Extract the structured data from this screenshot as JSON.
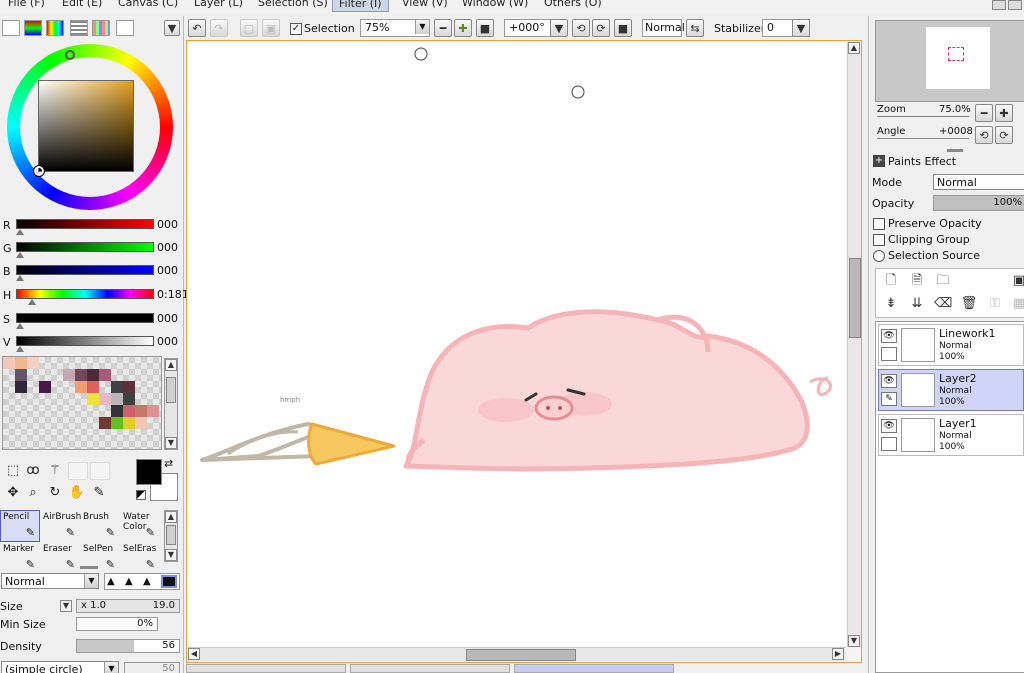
{
  "menu": {
    "items": [
      "File (F)",
      "Edit (E)",
      "Canvas (C)",
      "Layer (L)",
      "Selection (S)",
      "Filter (I)",
      "View (V)",
      "Window (W)",
      "Others (O)"
    ],
    "active_index": 5
  },
  "toolbar": {
    "selection_label": "Selection",
    "zoom_value": "75%",
    "angle_value": "+000°",
    "blend_value": "Normal",
    "stabilizer_label": "Stabilizer",
    "stabilizer_value": "0"
  },
  "color": {
    "sliders": [
      {
        "label": "R",
        "value": "000",
        "gradient": [
          "#000000",
          "#ff0000"
        ]
      },
      {
        "label": "G",
        "value": "000",
        "gradient": [
          "#000000",
          "#00ff00"
        ]
      },
      {
        "label": "B",
        "value": "000",
        "gradient": [
          "#000000",
          "#0000ff"
        ]
      },
      {
        "label": "H",
        "value": "0:181",
        "gradient": [
          "#ff0000",
          "#ffff00",
          "#00ff00",
          "#00ffff",
          "#0000ff",
          "#ff00ff",
          "#ff0000"
        ]
      },
      {
        "label": "S",
        "value": "000",
        "gradient": [
          "#000000",
          "#000000"
        ]
      },
      {
        "label": "V",
        "value": "000",
        "gradient": [
          "#000000",
          "#ffffff"
        ]
      }
    ],
    "foreground": "#000000",
    "background": "#ffffff",
    "swatches": [
      {
        "c": "#f4c8b8"
      },
      {
        "c": "#f0b890"
      },
      {
        "c": "#f8d0c0"
      },
      {
        "c": "#605868"
      },
      {
        "c": "#c8a8b0"
      },
      {
        "c": "#704858"
      },
      {
        "c": "#502838"
      },
      {
        "c": "#a85878"
      },
      {
        "c": "#302838"
      },
      {
        "c": "#481848"
      },
      {
        "c": "#f0a070"
      },
      {
        "c": "#e06060"
      },
      {
        "c": "#404048"
      },
      {
        "c": "#603038"
      },
      {
        "c": "#f0e040"
      },
      {
        "c": "#e8b8c8"
      },
      {
        "c": "#404040"
      },
      {
        "c": "#b8b8b8"
      },
      {
        "c": "#383038"
      },
      {
        "c": "#d06070"
      },
      {
        "c": "#c87868"
      },
      {
        "c": "#e09090"
      },
      {
        "c": "#60c020"
      },
      {
        "c": "#e0d020"
      },
      {
        "c": "#703838"
      },
      {
        "c": "#f0c8b0"
      }
    ]
  },
  "brushes": [
    {
      "name": "Pencil",
      "selected": true
    },
    {
      "name": "AirBrush",
      "selected": false
    },
    {
      "name": "Brush",
      "selected": false
    },
    {
      "name": "Water Color",
      "selected": false
    },
    {
      "name": "Marker",
      "selected": false
    },
    {
      "name": "Eraser",
      "selected": false
    },
    {
      "name": "SelPen",
      "selected": false
    },
    {
      "name": "SelEras",
      "selected": false
    }
  ],
  "brush_props": {
    "blend": "Normal",
    "size_label": "Size",
    "size_mult": "x 1.0",
    "size_value": "19.0",
    "min_size_label": "Min Size",
    "min_size_value": "0%",
    "density_label": "Density",
    "density_value": "56",
    "density_fraction": 0.56,
    "shape": "(simple circle)",
    "shape_value": "50"
  },
  "navigator": {
    "zoom_label": "Zoom",
    "zoom_value": "75.0%",
    "angle_label": "Angle",
    "angle_value": "+0008"
  },
  "layer_props": {
    "paints_effect": "Paints Effect",
    "mode_label": "Mode",
    "mode_value": "Normal",
    "opacity_label": "Opacity",
    "opacity_value": "100%",
    "preserve_opacity": "Preserve Opacity",
    "clipping_group": "Clipping Group",
    "selection_source": "Selection Source"
  },
  "layers": [
    {
      "name": "Linework1",
      "mode": "Normal",
      "opacity": "100%",
      "selected": false
    },
    {
      "name": "Layer2",
      "mode": "Normal",
      "opacity": "100%",
      "selected": true
    },
    {
      "name": "Layer1",
      "mode": "Normal",
      "opacity": "100%",
      "selected": false
    }
  ],
  "canvas": {
    "sketch_note": "hmph"
  }
}
